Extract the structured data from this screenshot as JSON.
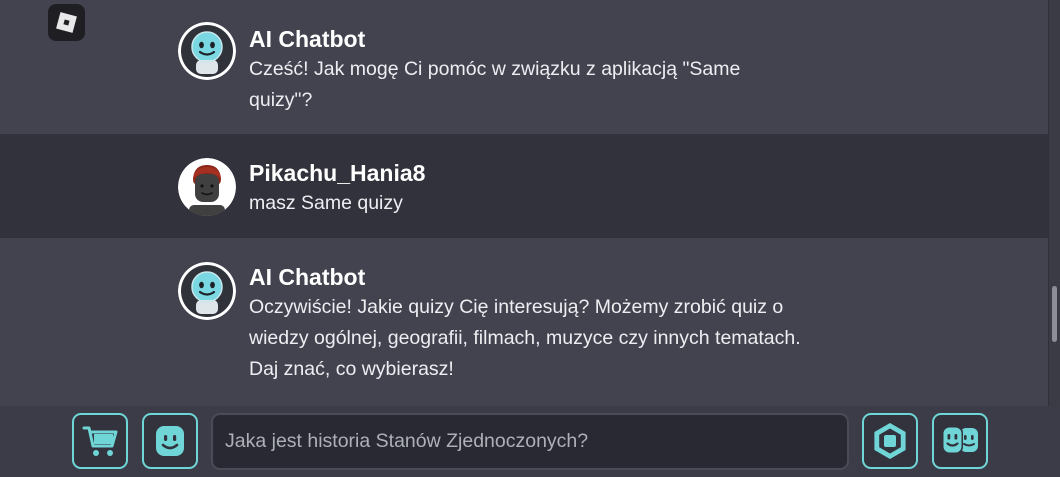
{
  "header": {
    "logo_icon": "roblox-logo-icon"
  },
  "messages": [
    {
      "username": "AI Chatbot",
      "avatar_icon": "robot-avatar-icon",
      "text": "Cześć! Jak mogę Ci pomóc w związku z aplikacją \"Same quizy\"?"
    },
    {
      "username": "Pikachu_Hania8",
      "avatar_icon": "user-avatar-icon",
      "text": "masz Same quizy"
    },
    {
      "username": "AI Chatbot",
      "avatar_icon": "robot-avatar-icon",
      "text": "Oczywiście! Jakie quizy Cię interesują? Możemy zrobić quiz o wiedzy ogólnej, geografii, filmach, muzyce czy innych tematach. Daj znać, co wybierasz!"
    }
  ],
  "composer": {
    "placeholder": "Jaka jest historia Stanów Zjednoczonych?"
  },
  "buttons": {
    "shop_icon": "shopping-cart-icon",
    "avatar_icon": "avatar-face-icon",
    "robux_icon": "robux-icon",
    "friends_icon": "friends-icon"
  },
  "colors": {
    "accent": "#6fd5d6",
    "bot_row_bg": "#42434f",
    "user_row_bg": "#31323c",
    "bottom_bar_bg": "#3b3c47"
  },
  "scrollbar": {
    "position": 0.7
  }
}
